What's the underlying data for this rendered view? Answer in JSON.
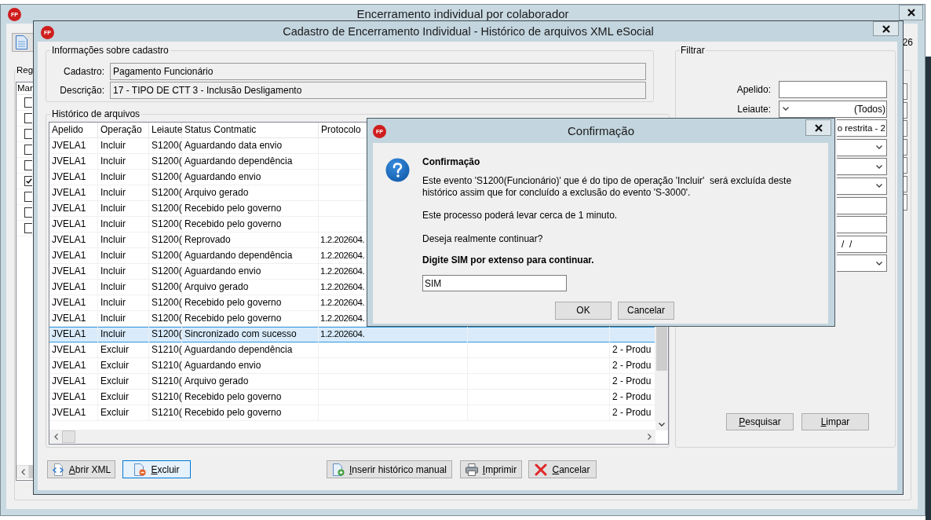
{
  "back_window": {
    "logo": "FP",
    "title": "Encerramento individual por colaborador",
    "top_right_text": "26",
    "records_group": {
      "title": "Reg",
      "column_1": "Mar",
      "rows": [
        {
          "checked": false
        },
        {
          "checked": false
        },
        {
          "checked": false
        },
        {
          "checked": false
        },
        {
          "checked": false
        },
        {
          "checked": true
        },
        {
          "checked": false
        },
        {
          "checked": false
        },
        {
          "checked": false
        }
      ]
    }
  },
  "main_window": {
    "logo": "FP",
    "title": "Cadastro de Encerramento Individual - Histórico de arquivos XML eSocial",
    "registration_info": {
      "title": "Informações sobre cadastro",
      "fields": [
        {
          "label": "Cadastro:",
          "value": "Pagamento Funcionário"
        },
        {
          "label": "Descrição:",
          "value": "17 - TIPO DE CTT 3 - Inclusão Desligamento"
        }
      ]
    },
    "file_history": {
      "title": "Histórico de arquivos",
      "columns": [
        "Apelido",
        "Operação",
        "Leiaute",
        "Status Contmatic",
        "Protocolo"
      ],
      "rows": [
        {
          "nickname": "JVELA1",
          "operation": "Incluir",
          "layout": "S1200(",
          "status": "Aguardando data envio",
          "selected": false
        },
        {
          "nickname": "JVELA1",
          "operation": "Incluir",
          "layout": "S1200(",
          "status": "Aguardando dependência",
          "selected": false
        },
        {
          "nickname": "JVELA1",
          "operation": "Incluir",
          "layout": "S1200(",
          "status": "Aguardando envio",
          "selected": false
        },
        {
          "nickname": "JVELA1",
          "operation": "Incluir",
          "layout": "S1200(",
          "status": "Arquivo gerado",
          "selected": false
        },
        {
          "nickname": "JVELA1",
          "operation": "Incluir",
          "layout": "S1200(",
          "status": "Recebido pelo governo",
          "selected": false
        },
        {
          "nickname": "JVELA1",
          "operation": "Incluir",
          "layout": "S1200(",
          "status": "Recebido pelo governo",
          "selected": false
        },
        {
          "nickname": "JVELA1",
          "operation": "Incluir",
          "layout": "S1200(",
          "status": "Reprovado",
          "protocol": "1.2.202604.",
          "selected": false
        },
        {
          "nickname": "JVELA1",
          "operation": "Incluir",
          "layout": "S1200(",
          "status": "Aguardando dependência",
          "protocol": "1.2.202604.",
          "selected": false
        },
        {
          "nickname": "JVELA1",
          "operation": "Incluir",
          "layout": "S1200(",
          "status": "Aguardando envio",
          "protocol": "1.2.202604.",
          "selected": false
        },
        {
          "nickname": "JVELA1",
          "operation": "Incluir",
          "layout": "S1200(",
          "status": "Arquivo gerado",
          "protocol": "1.2.202604.",
          "selected": false
        },
        {
          "nickname": "JVELA1",
          "operation": "Incluir",
          "layout": "S1200(",
          "status": "Recebido pelo governo",
          "protocol": "1.2.202604.",
          "selected": false
        },
        {
          "nickname": "JVELA1",
          "operation": "Incluir",
          "layout": "S1200(",
          "status": "Recebido pelo governo",
          "protocol": "1.2.202604.",
          "selected": false
        },
        {
          "nickname": "JVELA1",
          "operation": "Incluir",
          "layout": "S1200(",
          "status": "Sincronizado com sucesso",
          "protocol": "1.2.202604.",
          "selected": true
        },
        {
          "nickname": "JVELA1",
          "operation": "Excluir",
          "layout": "S1210(",
          "status": "Aguardando dependência",
          "column_7": "2 - Produ",
          "selected": false
        },
        {
          "nickname": "JVELA1",
          "operation": "Excluir",
          "layout": "S1210(",
          "status": "Aguardando envio",
          "column_7": "2 - Produ",
          "selected": false
        },
        {
          "nickname": "JVELA1",
          "operation": "Excluir",
          "layout": "S1210(",
          "status": "Arquivo gerado",
          "column_7": "2 - Produ",
          "selected": false
        },
        {
          "nickname": "JVELA1",
          "operation": "Excluir",
          "layout": "S1210(",
          "status": "Recebido pelo governo",
          "column_7": "2 - Produ",
          "selected": false
        },
        {
          "nickname": "JVELA1",
          "operation": "Excluir",
          "layout": "S1210(",
          "status": "Recebido pelo governo",
          "column_7": "2 - Produ",
          "selected": false
        }
      ]
    },
    "filter": {
      "title": "Filtrar",
      "fields": [
        {
          "kind": "text",
          "label": "Apelido:"
        },
        {
          "kind": "dropdown_left",
          "label": "Leiaute:",
          "value": "(Todos)"
        },
        {
          "kind": "dropdown_left",
          "value": "o restrita - 2"
        },
        {
          "kind": "dropdown"
        },
        {
          "kind": "dropdown"
        },
        {
          "kind": "dropdown"
        },
        {
          "kind": "text"
        },
        {
          "kind": "text"
        },
        {
          "kind": "text",
          "value": "/  /"
        },
        {
          "kind": "dropdown"
        }
      ],
      "buttons": [
        "Pesquisar",
        "Limpar"
      ]
    },
    "buttons": [
      {
        "kind": "xml",
        "label": "Abrir XML",
        "focused": false
      },
      {
        "kind": "delete",
        "label": "Excluir",
        "focused": true
      },
      {
        "kind": "add",
        "label": "Inserir histórico manual",
        "focused": false
      },
      {
        "kind": "print",
        "label": "Imprimir",
        "focused": false
      },
      {
        "kind": "cancel",
        "label": "Cancelar",
        "focused": false
      }
    ]
  },
  "dialog": {
    "logo": "FP",
    "title": "Confirmação",
    "heading": "Confirmação",
    "message": "Este evento 'S1200(Funcionário)' que é do tipo de operação 'Incluir'  será excluída deste histórico assim que for concluído a exclusão do evento 'S-3000'.",
    "note": "Este processo poderá levar cerca de 1 minuto.",
    "question": "Deseja realmente continuar?",
    "prompt": "Digite SIM por extenso para continuar.",
    "input": {
      "value": "SIM"
    },
    "buttons": [
      "OK",
      "Cancelar"
    ]
  }
}
